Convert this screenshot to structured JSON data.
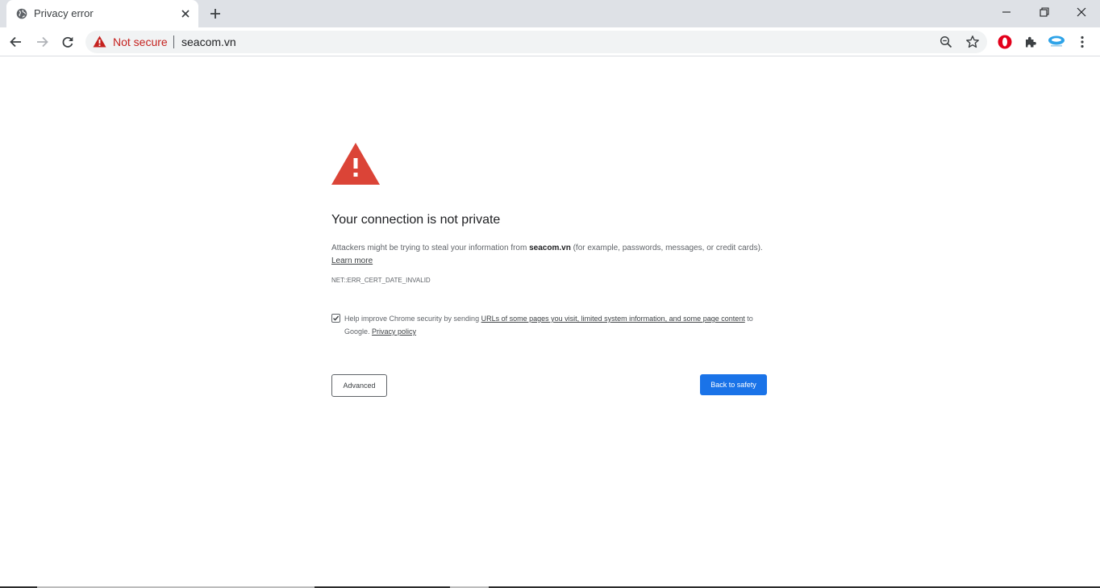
{
  "tab": {
    "title": "Privacy error",
    "icon": "globe-icon"
  },
  "toolbar": {
    "security_label": "Not secure",
    "url": "seacom.vn",
    "security_color": "#c5221f"
  },
  "interstitial": {
    "heading": "Your connection is not private",
    "explanation_prefix": "Attackers might be trying to steal your information from ",
    "explanation_host": "seacom.vn",
    "explanation_suffix": " (for example, passwords, messages, or credit cards).",
    "learn_more": "Learn more",
    "error_code": "NET::ERR_CERT_DATE_INVALID",
    "optin_prefix": "Help improve Chrome security by sending ",
    "optin_link": "URLs of some pages you visit, limited system information, and some page content",
    "optin_mid": " to Google. ",
    "privacy_policy": "Privacy policy",
    "optin_checked": true,
    "advanced_button": "Advanced",
    "back_button": "Back to safety",
    "icon_color": "#db4437",
    "primary_color": "#1a73e8"
  }
}
